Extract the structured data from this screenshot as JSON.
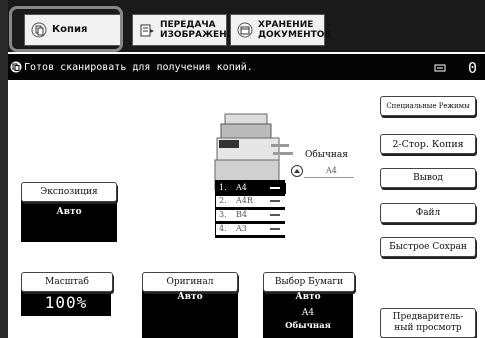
{
  "tabs": [
    {
      "label": "Копия",
      "active": true
    },
    {
      "label": "ПЕРЕДАЧА\nИЗОБРАЖЕНИЯ",
      "active": false
    },
    {
      "label": "ХРАНЕНИЕ\nДОКУМЕНТОВ",
      "active": false
    }
  ],
  "status": {
    "message": "Готов сканировать для получения копий.",
    "copies": "0"
  },
  "right_panel": {
    "special_modes": "Специальные Режимы",
    "duplex": "2-Стор. Копия",
    "output": "Вывод",
    "file": "Файл",
    "quick_file": "Быстрое Сохран",
    "preview": "Предваритель-\nный просмотр"
  },
  "exposure": {
    "label": "Экспозиция",
    "value": "Авто"
  },
  "scale": {
    "label": "Масштаб",
    "value": "100%"
  },
  "original": {
    "label": "Оригинал",
    "value": "Авто"
  },
  "paper": {
    "label": "Выбор Бумаги",
    "mode": "Авто",
    "size": "A4",
    "type": "Обычная"
  },
  "bypass": {
    "type": "Обычная",
    "size": "A4"
  },
  "trays": [
    {
      "num": "1.",
      "size": "A4",
      "selected": true
    },
    {
      "num": "2.",
      "size": "A4R",
      "selected": false
    },
    {
      "num": "3.",
      "size": "B4",
      "selected": false
    },
    {
      "num": "4.",
      "size": "A3",
      "selected": false
    }
  ],
  "colors": {
    "dark": "#000000",
    "panel": "#1a1a1a",
    "button_face": "#ffffff",
    "highlight_border": "#888888"
  }
}
